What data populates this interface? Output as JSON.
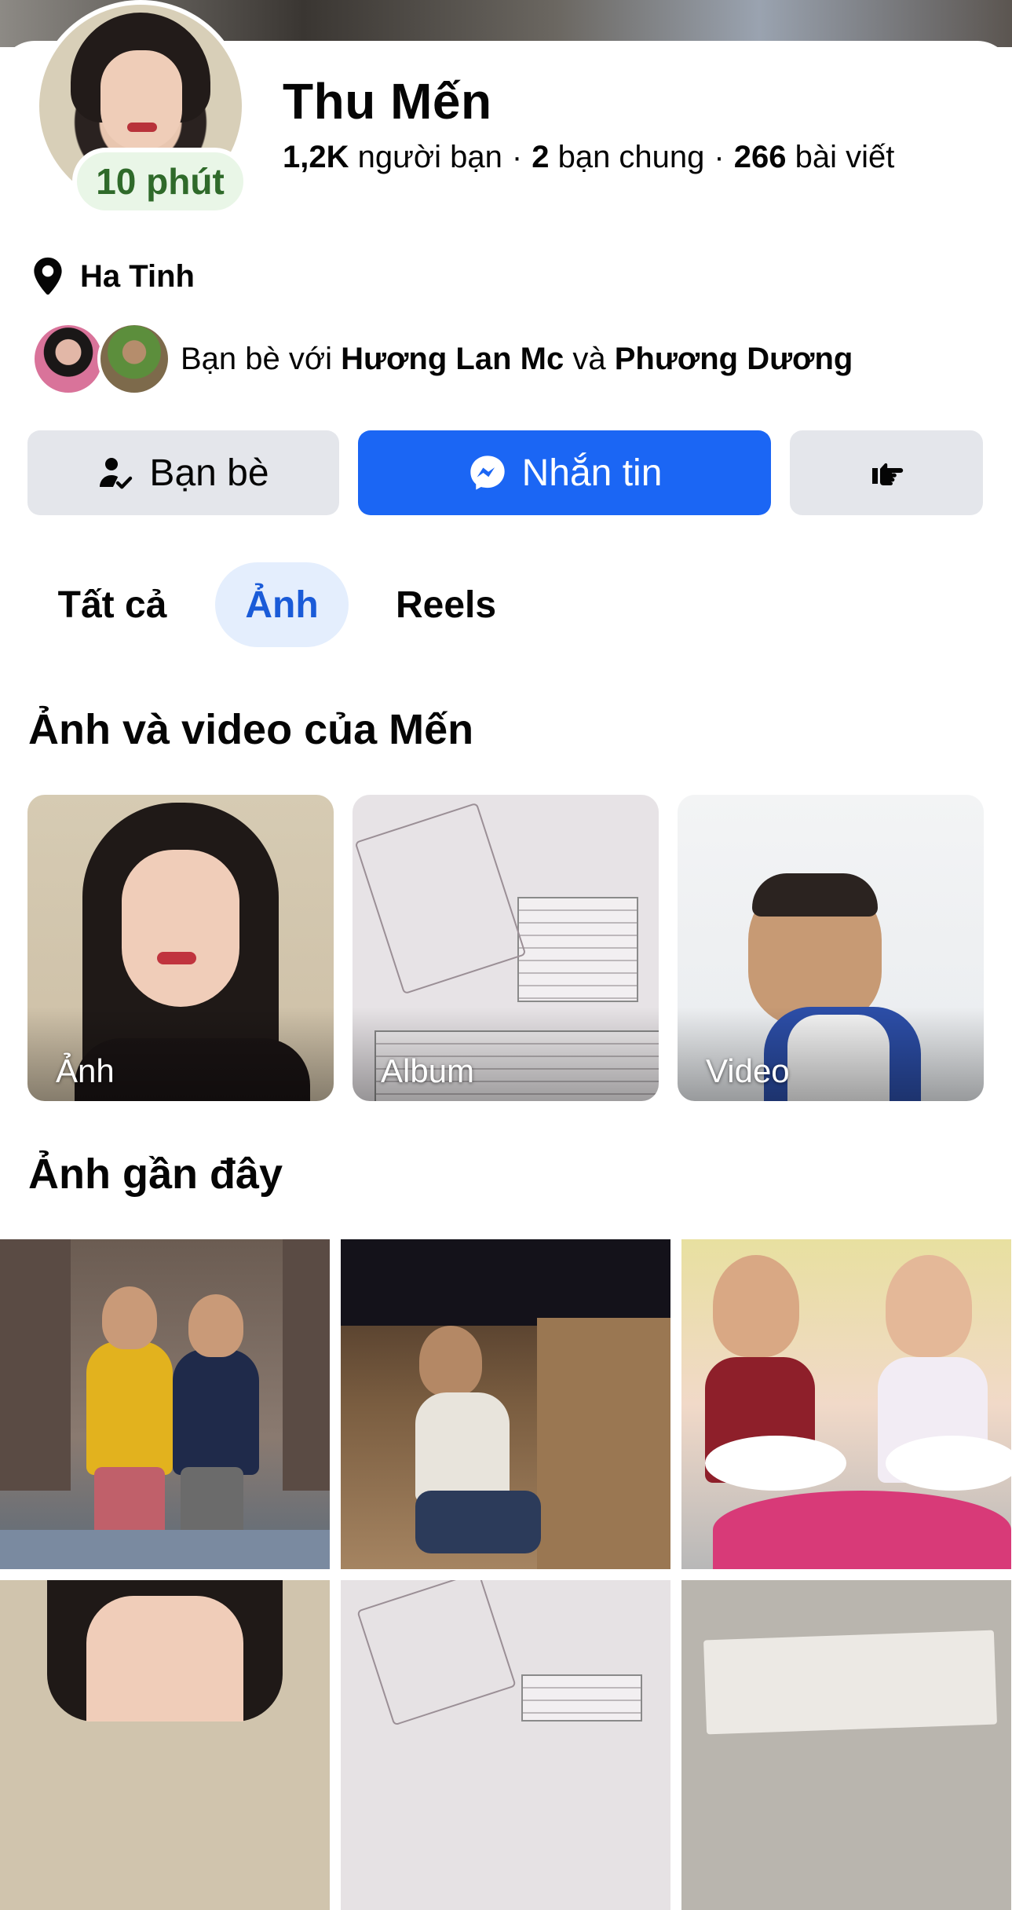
{
  "profile": {
    "name": "Thu Mến",
    "active_status": "10 phút",
    "friends_count": "1,2K",
    "friends_label": "người bạn",
    "mutual_count": "2",
    "mutual_label": "bạn chung",
    "posts_count": "266",
    "posts_label": "bài viết",
    "separator": "·",
    "location": "Ha Tinh",
    "mutual_prefix": "Bạn bè với",
    "mutual_friend_1": "Hương Lan Mc",
    "mutual_joiner": "và",
    "mutual_friend_2": "Phương Dương"
  },
  "actions": {
    "friends_label": "Bạn bè",
    "message_label": "Nhắn tin",
    "accent_color": "#1b66f4"
  },
  "tabs": [
    {
      "label": "Tất cả",
      "active": false
    },
    {
      "label": "Ảnh",
      "active": true
    },
    {
      "label": "Reels",
      "active": false
    }
  ],
  "media_section": {
    "title": "Ảnh và video của Mến",
    "cards": [
      {
        "label": "Ảnh"
      },
      {
        "label": "Album"
      },
      {
        "label": "Video"
      }
    ]
  },
  "recent_section": {
    "title": "Ảnh gần đây"
  },
  "icons": {
    "location": "map-pin-icon",
    "friends": "person-check-icon",
    "message": "messenger-icon",
    "more": "poke-hand-icon"
  }
}
